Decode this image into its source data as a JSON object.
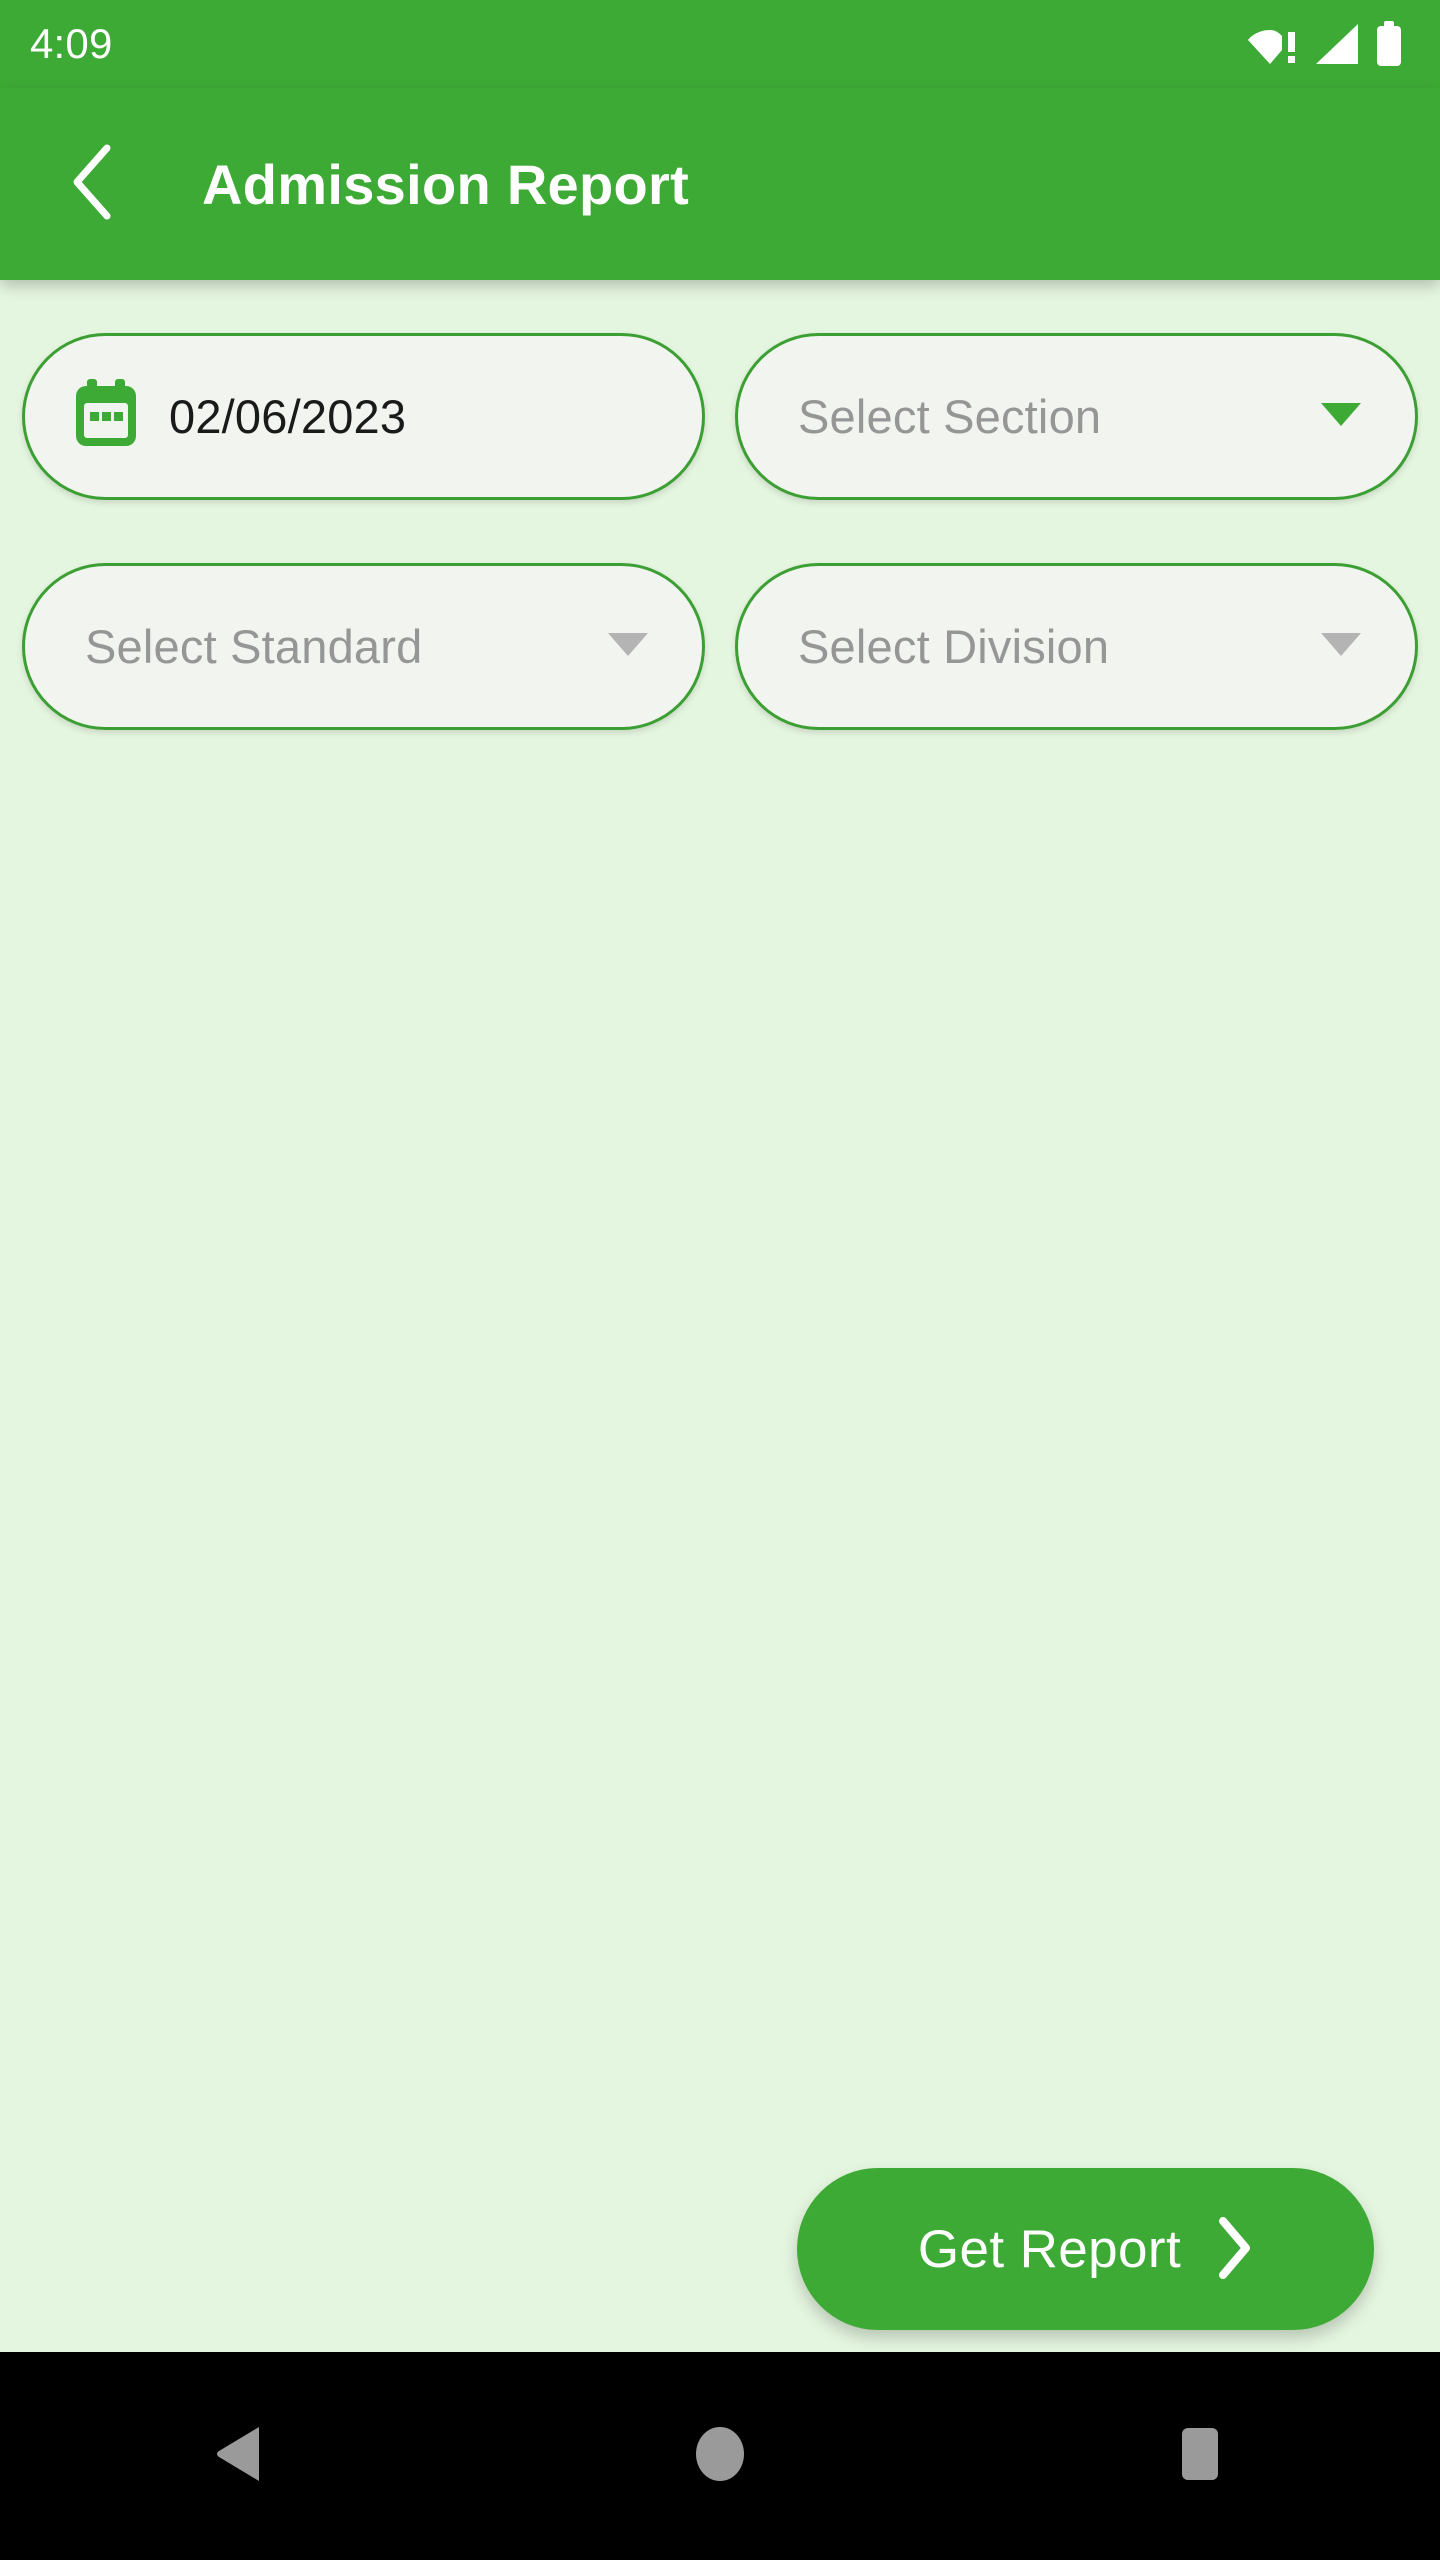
{
  "theme": {
    "primary_green": "#3daa35",
    "border_green": "#3c9f33",
    "body_background": "#e5f6e0",
    "field_fill": "#f1f4ef",
    "placeholder_gray": "#969696",
    "disabled_caret_gray": "#b4b4b4",
    "nav_icon_gray": "#9a9a9a"
  },
  "status_bar": {
    "clock": "4:09",
    "icons": [
      {
        "name": "wifi-alert-icon",
        "label": "wifi-alert"
      },
      {
        "name": "cellular-signal-icon",
        "label": "cellular-signal"
      },
      {
        "name": "battery-full-icon",
        "label": "battery-full"
      }
    ]
  },
  "app_bar": {
    "back_icon": "chevron-left-icon",
    "title": "Admission Report"
  },
  "filters": {
    "date_field": {
      "icon": "calendar-icon",
      "value": "02/06/2023"
    },
    "section_field": {
      "placeholder": "Select Section",
      "caret_icon": "chevron-down-icon",
      "enabled": true
    },
    "standard_field": {
      "placeholder": "Select Standard",
      "caret_icon": "chevron-down-icon",
      "enabled": false
    },
    "division_field": {
      "placeholder": "Select Division",
      "caret_icon": "chevron-down-icon",
      "enabled": false
    }
  },
  "actions": {
    "get_report": {
      "label": "Get Report",
      "icon": "chevron-right-icon"
    }
  },
  "navigation_bar": {
    "back": "back-triangle-icon",
    "home": "home-circle-icon",
    "recents": "recents-square-icon"
  }
}
